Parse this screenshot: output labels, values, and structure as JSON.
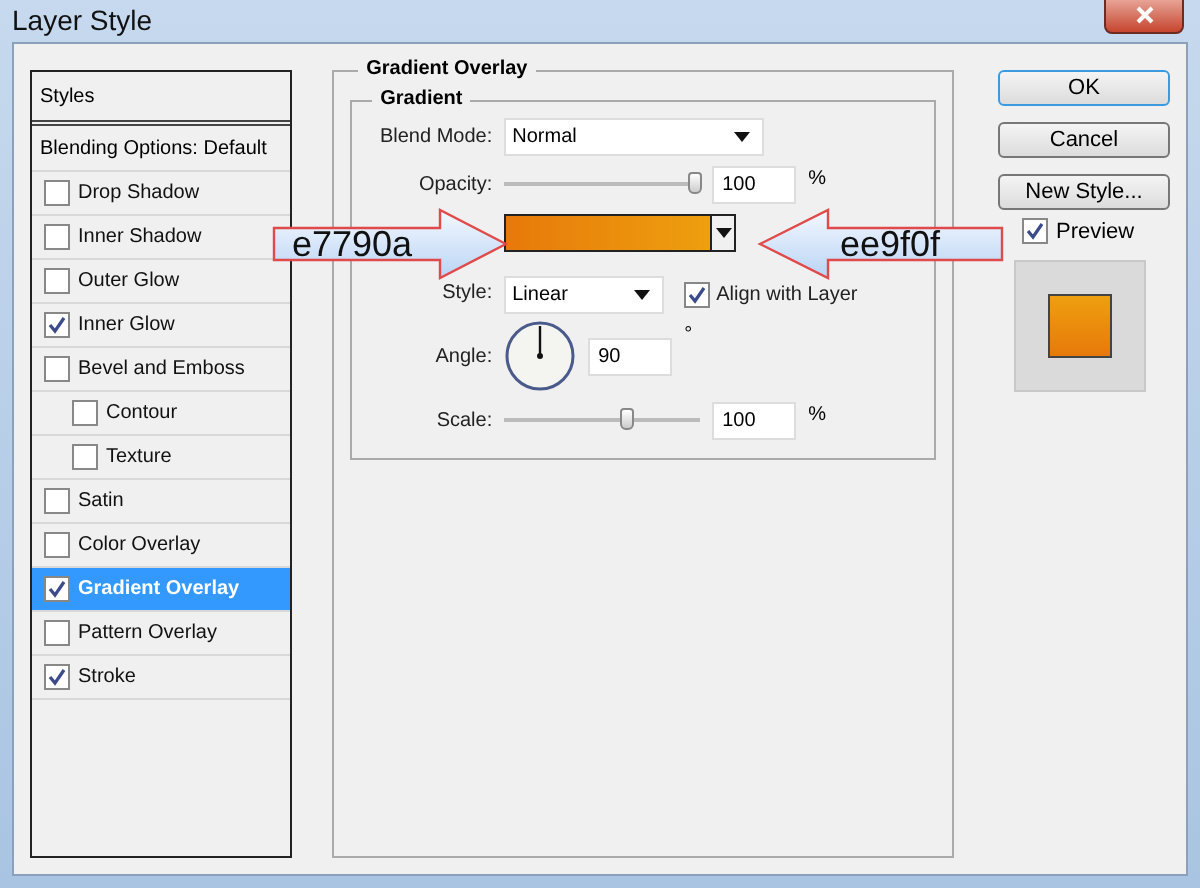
{
  "window": {
    "title": "Layer Style"
  },
  "styles_panel": {
    "header": "Styles",
    "blending": "Blending Options: Default",
    "items": [
      {
        "label": "Drop Shadow",
        "checked": false,
        "selected": false,
        "sub": false
      },
      {
        "label": "Inner Shadow",
        "checked": false,
        "selected": false,
        "sub": false
      },
      {
        "label": "Outer Glow",
        "checked": false,
        "selected": false,
        "sub": false
      },
      {
        "label": "Inner Glow",
        "checked": true,
        "selected": false,
        "sub": false
      },
      {
        "label": "Bevel and Emboss",
        "checked": false,
        "selected": false,
        "sub": false
      },
      {
        "label": "Contour",
        "checked": false,
        "selected": false,
        "sub": true
      },
      {
        "label": "Texture",
        "checked": false,
        "selected": false,
        "sub": true
      },
      {
        "label": "Satin",
        "checked": false,
        "selected": false,
        "sub": false
      },
      {
        "label": "Color Overlay",
        "checked": false,
        "selected": false,
        "sub": false
      },
      {
        "label": "Gradient Overlay",
        "checked": true,
        "selected": true,
        "sub": false
      },
      {
        "label": "Pattern Overlay",
        "checked": false,
        "selected": false,
        "sub": false
      },
      {
        "label": "Stroke",
        "checked": true,
        "selected": false,
        "sub": false
      }
    ]
  },
  "gradient_overlay": {
    "title": "Gradient Overlay",
    "group_title": "Gradient",
    "blend_mode": {
      "label": "Blend Mode:",
      "value": "Normal"
    },
    "opacity": {
      "label": "Opacity:",
      "level": 0.98,
      "value": "100",
      "unit": "%"
    },
    "style": {
      "label": "Style:",
      "value": "Linear"
    },
    "align": {
      "label": "Align with Layer",
      "checked": true
    },
    "angle": {
      "label": "Angle:",
      "value": "90",
      "unit": "°"
    },
    "scale": {
      "label": "Scale:",
      "level": 0.63,
      "value": "100",
      "unit": "%"
    }
  },
  "buttons": [
    {
      "label": "OK",
      "default": true
    },
    {
      "label": "Cancel",
      "default": false
    },
    {
      "label": "New Style...",
      "default": false
    }
  ],
  "preview": {
    "label": "Preview",
    "checked": true
  },
  "callouts": [
    {
      "text": "e7790a",
      "kind": "right"
    },
    {
      "text": "ee9f0f",
      "kind": "left"
    }
  ]
}
